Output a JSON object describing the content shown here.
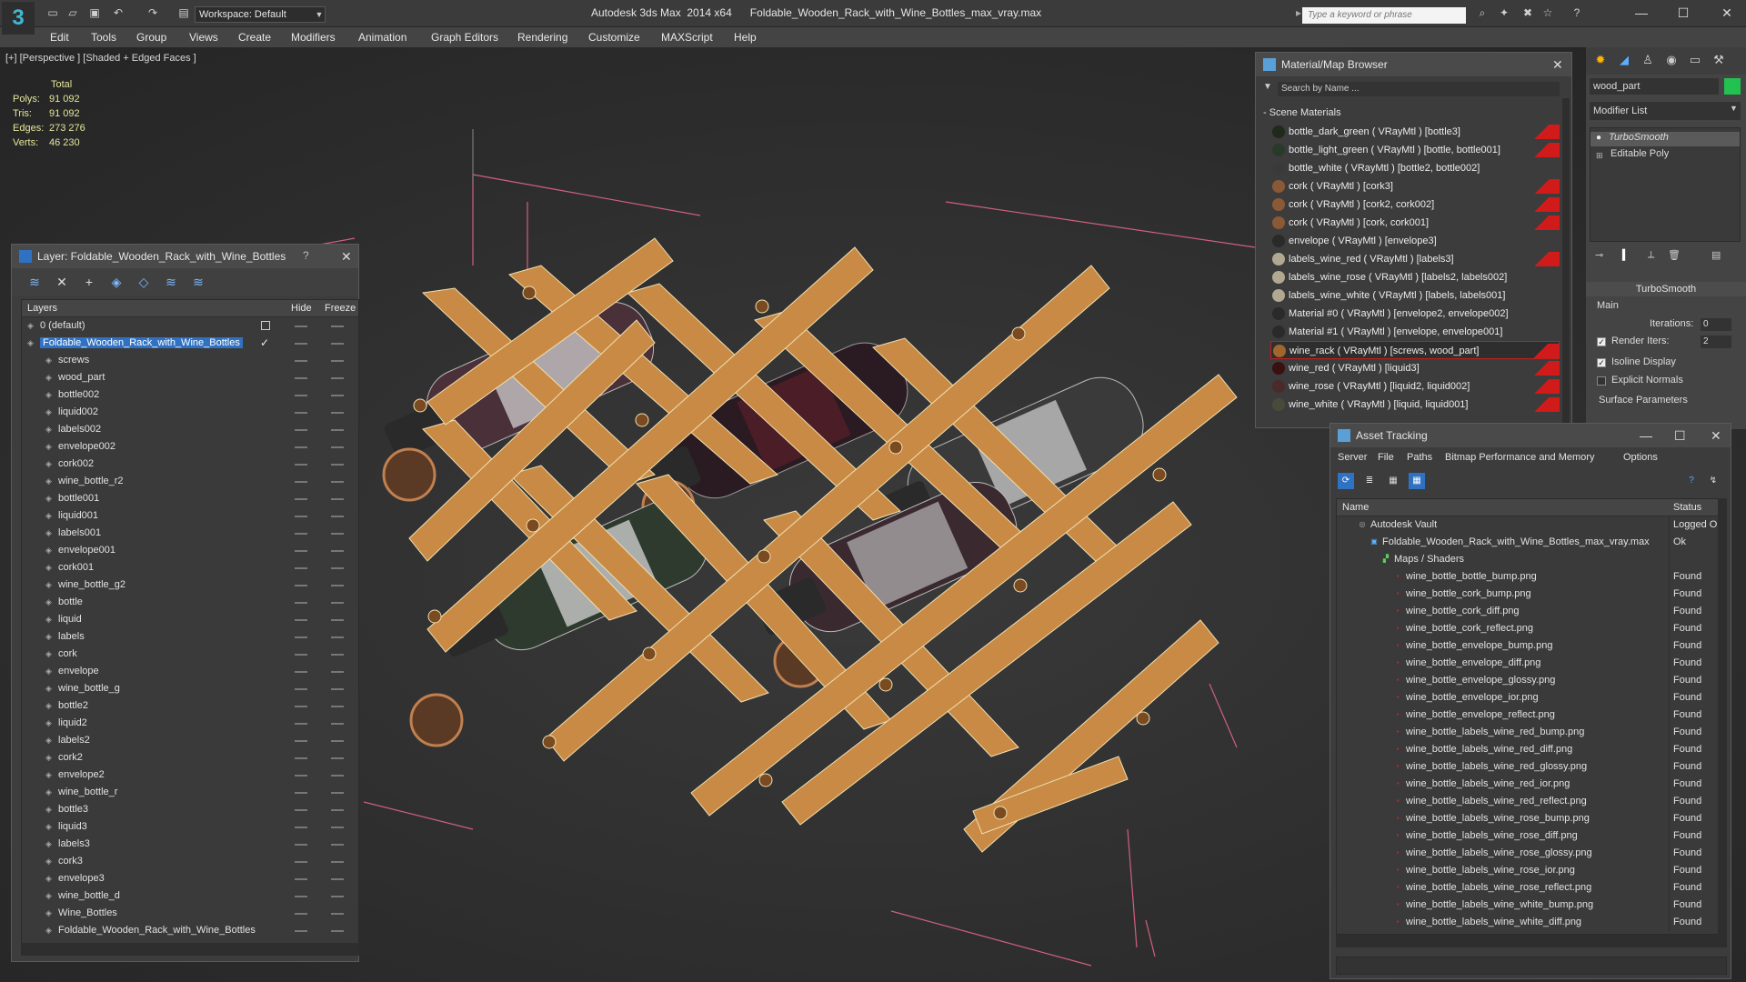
{
  "app": {
    "title": "Autodesk 3ds Max  2014 x64      Foldable_Wooden_Rack_with_Wine_Bottles_max_vray.max",
    "workspace": "Workspace: Default",
    "search_placeholder": "Type a keyword or phrase",
    "logo_glyph": "3"
  },
  "menu": [
    "Edit",
    "Tools",
    "Group",
    "Views",
    "Create",
    "Modifiers",
    "Animation",
    "Graph Editors",
    "Rendering",
    "Customize",
    "MAXScript",
    "Help"
  ],
  "viewport": {
    "label": "[+] [Perspective ] [Shaded + Edged Faces ]",
    "stats": {
      "total_label": "Total",
      "rows": [
        {
          "key": "Polys:",
          "value": "91 092"
        },
        {
          "key": "Tris:",
          "value": "91 092"
        },
        {
          "key": "Edges:",
          "value": "273 276"
        },
        {
          "key": "Verts:",
          "value": "46 230"
        }
      ]
    }
  },
  "layer_panel": {
    "title": "Layer: Foldable_Wooden_Rack_with_Wine_Bottles",
    "help": "?",
    "columns": {
      "layers": "Layers",
      "hide": "Hide",
      "freeze": "Freeze"
    },
    "rows": [
      {
        "name": "0 (default)",
        "level": 1,
        "selected": false
      },
      {
        "name": "Foldable_Wooden_Rack_with_Wine_Bottles",
        "level": 1,
        "selected": true
      },
      {
        "name": "screws",
        "level": 2
      },
      {
        "name": "wood_part",
        "level": 2
      },
      {
        "name": "bottle002",
        "level": 2
      },
      {
        "name": "liquid002",
        "level": 2
      },
      {
        "name": "labels002",
        "level": 2
      },
      {
        "name": "envelope002",
        "level": 2
      },
      {
        "name": "cork002",
        "level": 2
      },
      {
        "name": "wine_bottle_r2",
        "level": 2
      },
      {
        "name": "bottle001",
        "level": 2
      },
      {
        "name": "liquid001",
        "level": 2
      },
      {
        "name": "labels001",
        "level": 2
      },
      {
        "name": "envelope001",
        "level": 2
      },
      {
        "name": "cork001",
        "level": 2
      },
      {
        "name": "wine_bottle_g2",
        "level": 2
      },
      {
        "name": "bottle",
        "level": 2
      },
      {
        "name": "liquid",
        "level": 2
      },
      {
        "name": "labels",
        "level": 2
      },
      {
        "name": "cork",
        "level": 2
      },
      {
        "name": "envelope",
        "level": 2
      },
      {
        "name": "wine_bottle_g",
        "level": 2
      },
      {
        "name": "bottle2",
        "level": 2
      },
      {
        "name": "liquid2",
        "level": 2
      },
      {
        "name": "labels2",
        "level": 2
      },
      {
        "name": "cork2",
        "level": 2
      },
      {
        "name": "envelope2",
        "level": 2
      },
      {
        "name": "wine_bottle_r",
        "level": 2
      },
      {
        "name": "bottle3",
        "level": 2
      },
      {
        "name": "liquid3",
        "level": 2
      },
      {
        "name": "labels3",
        "level": 2
      },
      {
        "name": "cork3",
        "level": 2
      },
      {
        "name": "envelope3",
        "level": 2
      },
      {
        "name": "wine_bottle_d",
        "level": 2
      },
      {
        "name": "Wine_Bottles",
        "level": 2
      },
      {
        "name": "Foldable_Wooden_Rack_with_Wine_Bottles",
        "level": 2
      }
    ]
  },
  "material_browser": {
    "title": "Material/Map Browser",
    "search_placeholder": "Search by Name ...",
    "section": "- Scene Materials",
    "items": [
      {
        "label": "bottle_dark_green  ( VRayMtl ) [bottle3]",
        "swatch": "#1f2a1c",
        "flag": true
      },
      {
        "label": "bottle_light_green  ( VRayMtl ) [bottle, bottle001]",
        "swatch": "#2a3a2a",
        "flag": true
      },
      {
        "label": "bottle_white  ( VRayMtl ) [bottle2, bottle002]",
        "swatch": "#3a3a3a",
        "flag": false
      },
      {
        "label": "cork  ( VRayMtl ) [cork3]",
        "swatch": "#8a5a36",
        "flag": true
      },
      {
        "label": "cork  ( VRayMtl ) [cork2, cork002]",
        "swatch": "#8a5a36",
        "flag": true
      },
      {
        "label": "cork  ( VRayMtl ) [cork, cork001]",
        "swatch": "#8a5a36",
        "flag": true
      },
      {
        "label": "envelope  ( VRayMtl ) [envelope3]",
        "swatch": "#2a2a2a",
        "flag": false
      },
      {
        "label": "labels_wine_red  ( VRayMtl ) [labels3]",
        "swatch": "#b0a890",
        "flag": true
      },
      {
        "label": "labels_wine_rose  ( VRayMtl ) [labels2, labels002]",
        "swatch": "#b0a890",
        "flag": false
      },
      {
        "label": "labels_wine_white  ( VRayMtl ) [labels, labels001]",
        "swatch": "#b0a890",
        "flag": false
      },
      {
        "label": "Material #0  ( VRayMtl ) [envelope2, envelope002]",
        "swatch": "#2a2a2a",
        "flag": false
      },
      {
        "label": "Material #1  ( VRayMtl ) [envelope, envelope001]",
        "swatch": "#2a2a2a",
        "flag": false
      },
      {
        "label": "wine_rack  ( VRayMtl ) [screws, wood_part]",
        "swatch": "#a0662e",
        "flag": true,
        "selected": true
      },
      {
        "label": "wine_red  ( VRayMtl ) [liquid3]",
        "swatch": "#3a1010",
        "flag": true
      },
      {
        "label": "wine_rose  ( VRayMtl ) [liquid2, liquid002]",
        "swatch": "#4a2a2a",
        "flag": true
      },
      {
        "label": "wine_white  ( VRayMtl ) [liquid, liquid001]",
        "swatch": "#4a4a3a",
        "flag": true
      }
    ]
  },
  "command_panel": {
    "object_name": "wood_part",
    "object_color": "#21c24f",
    "modifier_list": "Modifier List",
    "stack": [
      "TurboSmooth",
      "Editable Poly"
    ],
    "turbosmooth": {
      "title": "TurboSmooth",
      "main_label": "Main",
      "iterations_label": "Iterations:",
      "iterations_value": "0",
      "render_iters_label": "Render Iters:",
      "render_iters_value": "2",
      "isoline_label": "Isoline Display",
      "explicit_label": "Explicit Normals",
      "surface_label": "Surface Parameters"
    }
  },
  "asset_tracking": {
    "title": "Asset Tracking",
    "menu": [
      "Server",
      "File",
      "Paths",
      "Bitmap Performance and Memory",
      "Options"
    ],
    "columns": {
      "name": "Name",
      "status": "Status"
    },
    "rows": [
      {
        "name": "Autodesk Vault",
        "status": "Logged O",
        "level": 1,
        "kind": "vault"
      },
      {
        "name": "Foldable_Wooden_Rack_with_Wine_Bottles_max_vray.max",
        "status": "Ok",
        "level": 2,
        "kind": "max"
      },
      {
        "name": "Maps / Shaders",
        "status": "",
        "level": 3,
        "kind": "folder"
      },
      {
        "name": "wine_bottle_bottle_bump.png",
        "status": "Found",
        "level": 4,
        "kind": "png"
      },
      {
        "name": "wine_bottle_cork_bump.png",
        "status": "Found",
        "level": 4,
        "kind": "png"
      },
      {
        "name": "wine_bottle_cork_diff.png",
        "status": "Found",
        "level": 4,
        "kind": "png"
      },
      {
        "name": "wine_bottle_cork_reflect.png",
        "status": "Found",
        "level": 4,
        "kind": "png"
      },
      {
        "name": "wine_bottle_envelope_bump.png",
        "status": "Found",
        "level": 4,
        "kind": "png"
      },
      {
        "name": "wine_bottle_envelope_diff.png",
        "status": "Found",
        "level": 4,
        "kind": "png"
      },
      {
        "name": "wine_bottle_envelope_glossy.png",
        "status": "Found",
        "level": 4,
        "kind": "png"
      },
      {
        "name": "wine_bottle_envelope_ior.png",
        "status": "Found",
        "level": 4,
        "kind": "png"
      },
      {
        "name": "wine_bottle_envelope_reflect.png",
        "status": "Found",
        "level": 4,
        "kind": "png"
      },
      {
        "name": "wine_bottle_labels_wine_red_bump.png",
        "status": "Found",
        "level": 4,
        "kind": "png"
      },
      {
        "name": "wine_bottle_labels_wine_red_diff.png",
        "status": "Found",
        "level": 4,
        "kind": "png"
      },
      {
        "name": "wine_bottle_labels_wine_red_glossy.png",
        "status": "Found",
        "level": 4,
        "kind": "png"
      },
      {
        "name": "wine_bottle_labels_wine_red_ior.png",
        "status": "Found",
        "level": 4,
        "kind": "png"
      },
      {
        "name": "wine_bottle_labels_wine_red_reflect.png",
        "status": "Found",
        "level": 4,
        "kind": "png"
      },
      {
        "name": "wine_bottle_labels_wine_rose_bump.png",
        "status": "Found",
        "level": 4,
        "kind": "png"
      },
      {
        "name": "wine_bottle_labels_wine_rose_diff.png",
        "status": "Found",
        "level": 4,
        "kind": "png"
      },
      {
        "name": "wine_bottle_labels_wine_rose_glossy.png",
        "status": "Found",
        "level": 4,
        "kind": "png"
      },
      {
        "name": "wine_bottle_labels_wine_rose_ior.png",
        "status": "Found",
        "level": 4,
        "kind": "png"
      },
      {
        "name": "wine_bottle_labels_wine_rose_reflect.png",
        "status": "Found",
        "level": 4,
        "kind": "png"
      },
      {
        "name": "wine_bottle_labels_wine_white_bump.png",
        "status": "Found",
        "level": 4,
        "kind": "png"
      },
      {
        "name": "wine_bottle_labels_wine_white_diff.png",
        "status": "Found",
        "level": 4,
        "kind": "png"
      }
    ]
  },
  "colors": {
    "selection_blue": "#2f72c4",
    "stats_yellow": "#e5e59b",
    "wood": "#c98a45",
    "material_flag_red": "#d11a1a"
  }
}
